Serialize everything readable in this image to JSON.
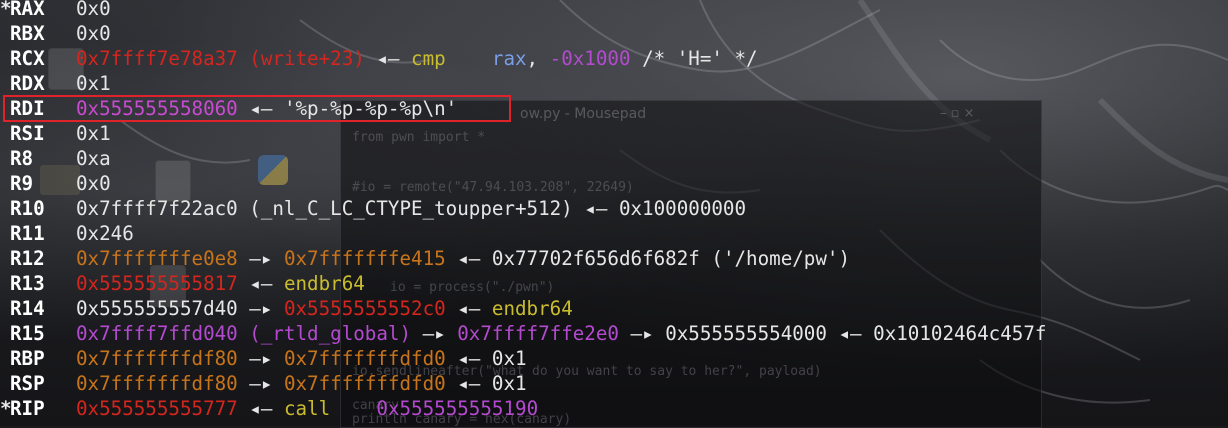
{
  "background": {
    "editor_title": "ow.py - Mousepad",
    "editor_controls": "– ▫ ×",
    "editor_lines": [
      "from pwn import *",
      "#io = remote(\"47.94.103.208\", 22649)",
      "io = process(\"./pwn\")",
      "io.sendlineafter(\"what do you want to say to her?\", payload)",
      "canary",
      "println canary = hex(canary)"
    ]
  },
  "registers": [
    {
      "name": "RAX",
      "changed": true,
      "marker": "*",
      "segments": [
        {
          "text": "0x0",
          "color": "white"
        }
      ]
    },
    {
      "name": "RBX",
      "changed": false,
      "marker": "",
      "segments": [
        {
          "text": "0x0",
          "color": "white"
        }
      ]
    },
    {
      "name": "RCX",
      "changed": false,
      "marker": "",
      "segments": [
        {
          "text": "0x7ffff7e78a37 (write+23)",
          "color": "red"
        },
        {
          "text": " ◂— ",
          "color": "white"
        },
        {
          "text": "cmp",
          "color": "yellow"
        },
        {
          "text": "    ",
          "color": "white"
        },
        {
          "text": "rax",
          "color": "blue"
        },
        {
          "text": ", ",
          "color": "white"
        },
        {
          "text": "-0x1000",
          "color": "purple"
        },
        {
          "text": " /* 'H=' */",
          "color": "white"
        }
      ]
    },
    {
      "name": "RDX",
      "changed": false,
      "marker": "",
      "segments": [
        {
          "text": "0x1",
          "color": "white"
        }
      ]
    },
    {
      "name": "RDI",
      "changed": false,
      "marker": "",
      "highlighted": true,
      "segments": [
        {
          "text": "0x555555558060",
          "color": "magenta"
        },
        {
          "text": " ◂— ",
          "color": "white"
        },
        {
          "text": "'%p-%p-%p-%p\\n'",
          "color": "white"
        }
      ]
    },
    {
      "name": "RSI",
      "changed": false,
      "marker": "",
      "segments": [
        {
          "text": "0x1",
          "color": "white"
        }
      ]
    },
    {
      "name": "R8",
      "changed": false,
      "marker": "",
      "segments": [
        {
          "text": "0xa",
          "color": "white"
        }
      ]
    },
    {
      "name": "R9",
      "changed": false,
      "marker": "",
      "segments": [
        {
          "text": "0x0",
          "color": "white"
        }
      ]
    },
    {
      "name": "R10",
      "changed": false,
      "marker": "",
      "segments": [
        {
          "text": "0x7ffff7f22ac0 (_nl_C_LC_CTYPE_toupper+512)",
          "color": "white"
        },
        {
          "text": " ◂— ",
          "color": "white"
        },
        {
          "text": "0x100000000",
          "color": "white"
        }
      ]
    },
    {
      "name": "R11",
      "changed": false,
      "marker": "",
      "segments": [
        {
          "text": "0x246",
          "color": "white"
        }
      ]
    },
    {
      "name": "R12",
      "changed": false,
      "marker": "",
      "segments": [
        {
          "text": "0x7fffffffe0e8",
          "color": "orange"
        },
        {
          "text": " —▸ ",
          "color": "white"
        },
        {
          "text": "0x7fffffffe415",
          "color": "orange"
        },
        {
          "text": " ◂— ",
          "color": "white"
        },
        {
          "text": "0x77702f656d6f682f ('/home/pw')",
          "color": "white"
        }
      ]
    },
    {
      "name": "R13",
      "changed": false,
      "marker": "",
      "segments": [
        {
          "text": "0x555555555817",
          "color": "red"
        },
        {
          "text": " ◂— ",
          "color": "white"
        },
        {
          "text": "endbr64",
          "color": "yellow"
        }
      ]
    },
    {
      "name": "R14",
      "changed": false,
      "marker": "",
      "segments": [
        {
          "text": "0x555555557d40",
          "color": "white"
        },
        {
          "text": " —▸ ",
          "color": "white"
        },
        {
          "text": "0x5555555552c0",
          "color": "red"
        },
        {
          "text": " ◂— ",
          "color": "white"
        },
        {
          "text": "endbr64",
          "color": "yellow"
        }
      ]
    },
    {
      "name": "R15",
      "changed": false,
      "marker": "",
      "segments": [
        {
          "text": "0x7ffff7ffd040 (_rtld_global)",
          "color": "purple"
        },
        {
          "text": " —▸ ",
          "color": "white"
        },
        {
          "text": "0x7ffff7ffe2e0",
          "color": "purple"
        },
        {
          "text": " —▸ ",
          "color": "white"
        },
        {
          "text": "0x555555554000",
          "color": "white"
        },
        {
          "text": " ◂— ",
          "color": "white"
        },
        {
          "text": "0x10102464c457f",
          "color": "white"
        }
      ]
    },
    {
      "name": "RBP",
      "changed": false,
      "marker": "",
      "segments": [
        {
          "text": "0x7fffffffdf80",
          "color": "orange"
        },
        {
          "text": " —▸ ",
          "color": "white"
        },
        {
          "text": "0x7fffffffdfd0",
          "color": "orange"
        },
        {
          "text": " ◂— ",
          "color": "white"
        },
        {
          "text": "0x1",
          "color": "white"
        }
      ]
    },
    {
      "name": "RSP",
      "changed": false,
      "marker": "",
      "segments": [
        {
          "text": "0x7fffffffdf80",
          "color": "orange"
        },
        {
          "text": " —▸ ",
          "color": "white"
        },
        {
          "text": "0x7fffffffdfd0",
          "color": "orange"
        },
        {
          "text": " ◂— ",
          "color": "white"
        },
        {
          "text": "0x1",
          "color": "white"
        }
      ]
    },
    {
      "name": "RIP",
      "changed": true,
      "marker": "*",
      "segments": [
        {
          "text": "0x555555555777",
          "color": "red"
        },
        {
          "text": " ◂— ",
          "color": "white"
        },
        {
          "text": "call",
          "color": "yellow"
        },
        {
          "text": "    ",
          "color": "white"
        },
        {
          "text": "0x555555555190",
          "color": "purple"
        }
      ]
    }
  ],
  "colors": {
    "white": "#e6e6e6",
    "red": "#d4261e",
    "orange": "#c8741b",
    "magenta": "#c94bd1",
    "yellow": "#c9bc2e",
    "blue": "#7a9de8",
    "purple": "#b44ad0",
    "highlight_border": "#e0232a"
  }
}
